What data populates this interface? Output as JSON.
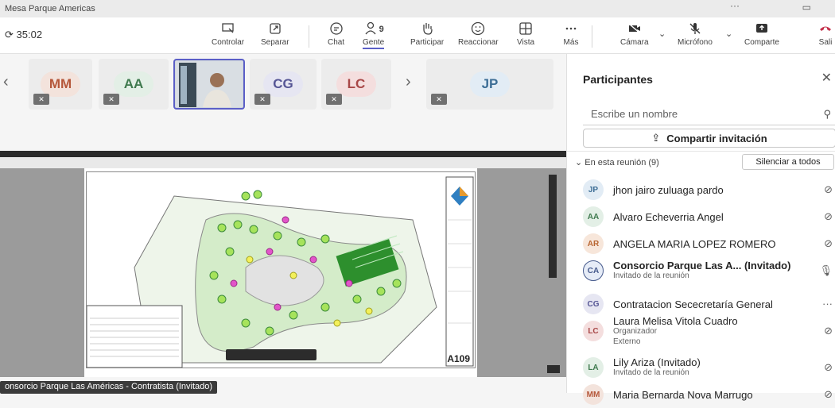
{
  "window": {
    "title": "Mesa Parque Americas",
    "controls": "···"
  },
  "toolbar": {
    "timer": "35:02",
    "buttons": [
      {
        "label": "Controlar",
        "icon": "control-icon"
      },
      {
        "label": "Separar",
        "icon": "popout-icon"
      },
      {
        "label": "Chat",
        "icon": "chat-icon"
      },
      {
        "label": "Gente",
        "icon": "people-icon",
        "count": "9"
      },
      {
        "label": "Participar",
        "icon": "raise-hand-icon"
      },
      {
        "label": "Reaccionar",
        "icon": "smile-icon"
      },
      {
        "label": "Vista",
        "icon": "grid-icon"
      },
      {
        "label": "Más",
        "icon": "more-icon"
      },
      {
        "label": "Cámara",
        "icon": "camera-off-icon"
      },
      {
        "label": "Micrófono",
        "icon": "mic-off-icon"
      },
      {
        "label": "Comparte",
        "icon": "share-icon"
      },
      {
        "label": "Sali",
        "icon": "hangup-icon"
      }
    ]
  },
  "tiles": [
    {
      "initials": "MM",
      "bg": "#f3e3dc",
      "fg": "#b5573a"
    },
    {
      "initials": "AA",
      "bg": "#e3efe6",
      "fg": "#3f7a4e"
    },
    {
      "initials": "CG",
      "bg": "#e6e6f2",
      "fg": "#565695"
    },
    {
      "initials": "LC",
      "bg": "#f4dede",
      "fg": "#a84747"
    },
    {
      "initials": "JP",
      "bg": "#e2ecf5",
      "fg": "#3d6e96"
    }
  ],
  "share": {
    "presenter_label": "onsorcio Parque Las Américas - Contratista (Invitado)",
    "sheet": "A109"
  },
  "panel": {
    "title": "Participantes",
    "search_placeholder": "Escribe un nombre",
    "invite_label": "Compartir invitación",
    "section": "En esta reunión (9)",
    "mute_all": "Silenciar a todos",
    "participants": [
      {
        "initials": "JP",
        "name": "jhon jairo zuluaga pardo",
        "sub1": "",
        "sub2": "",
        "bg": "#e2ecf5",
        "fg": "#3d6e96",
        "bold": false,
        "icon": "mic-off-icon"
      },
      {
        "initials": "AA",
        "name": "Alvaro Echeverria Angel",
        "sub1": "",
        "sub2": "",
        "bg": "#e3efe6",
        "fg": "#3f7a4e",
        "bold": false,
        "icon": "mic-off-icon"
      },
      {
        "initials": "AR",
        "name": "ANGELA MARIA LOPEZ ROMERO",
        "sub1": "",
        "sub2": "",
        "bg": "#f7e6da",
        "fg": "#b86530",
        "bold": false,
        "icon": "mic-off-icon"
      },
      {
        "initials": "CA",
        "name": "Consorcio Parque Las A...  (Invitado)",
        "sub1": "Invitado de la reunión",
        "sub2": "",
        "bg": "#e6ecf7",
        "fg": "#465a8c",
        "bold": true,
        "icon": "mic-on-icon"
      },
      {
        "initials": "CG",
        "name": "Contratacion Sececretaría General",
        "sub1": "",
        "sub2": "",
        "bg": "#e6e6f2",
        "fg": "#565695",
        "bold": false,
        "icon": "more-icon"
      },
      {
        "initials": "LC",
        "name": "Laura Melisa Vitola Cuadro",
        "sub1": "Organizador",
        "sub2": "Externo",
        "bg": "#f4dede",
        "fg": "#a84747",
        "bold": false,
        "icon": "mic-off-icon"
      },
      {
        "initials": "LA",
        "name": "Lily Ariza (Invitado)",
        "sub1": "Invitado de la reunión",
        "sub2": "",
        "bg": "#e3efe6",
        "fg": "#3f7a4e",
        "bold": false,
        "icon": "mic-off-icon"
      },
      {
        "initials": "MM",
        "name": "Maria Bernarda Nova Marrugo",
        "sub1": "",
        "sub2": "",
        "bg": "#f3e3dc",
        "fg": "#b5573a",
        "bold": false,
        "icon": "mic-off-icon"
      }
    ]
  }
}
